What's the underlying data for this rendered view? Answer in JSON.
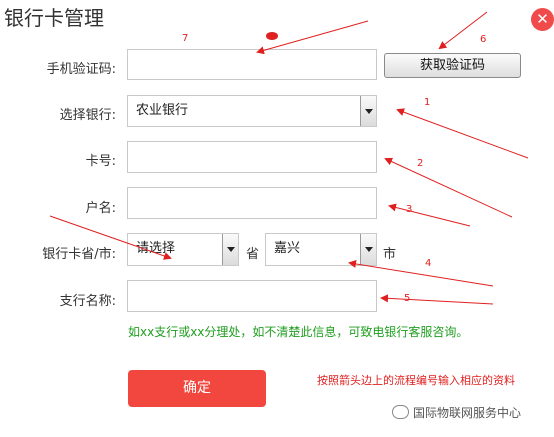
{
  "page": {
    "title": "银行卡管理",
    "close_symbol": "✕"
  },
  "form": {
    "sms_code": {
      "label": "手机验证码:",
      "button": "获取验证码"
    },
    "bank": {
      "label": "选择银行:",
      "value": "农业银行"
    },
    "card_no": {
      "label": "卡号:"
    },
    "account_name": {
      "label": "户名:"
    },
    "region": {
      "label": "银行卡省/市:",
      "province_value": "请选择",
      "province_suffix": "省",
      "city_value": "嘉兴",
      "city_suffix": "市"
    },
    "branch": {
      "label": "支行名称:"
    },
    "hint": "如xx支行或xx分理处，如不清楚此信息，可致电银行客服咨询。",
    "confirm_label": "确定"
  },
  "annotations": {
    "numbers": [
      "1",
      "2",
      "3",
      "4",
      "5",
      "6",
      "7"
    ],
    "note": "按照箭头边上的流程编号输入相应的资料",
    "color": "#e02020"
  },
  "watermark": {
    "text": "国际物联网服务中心"
  }
}
